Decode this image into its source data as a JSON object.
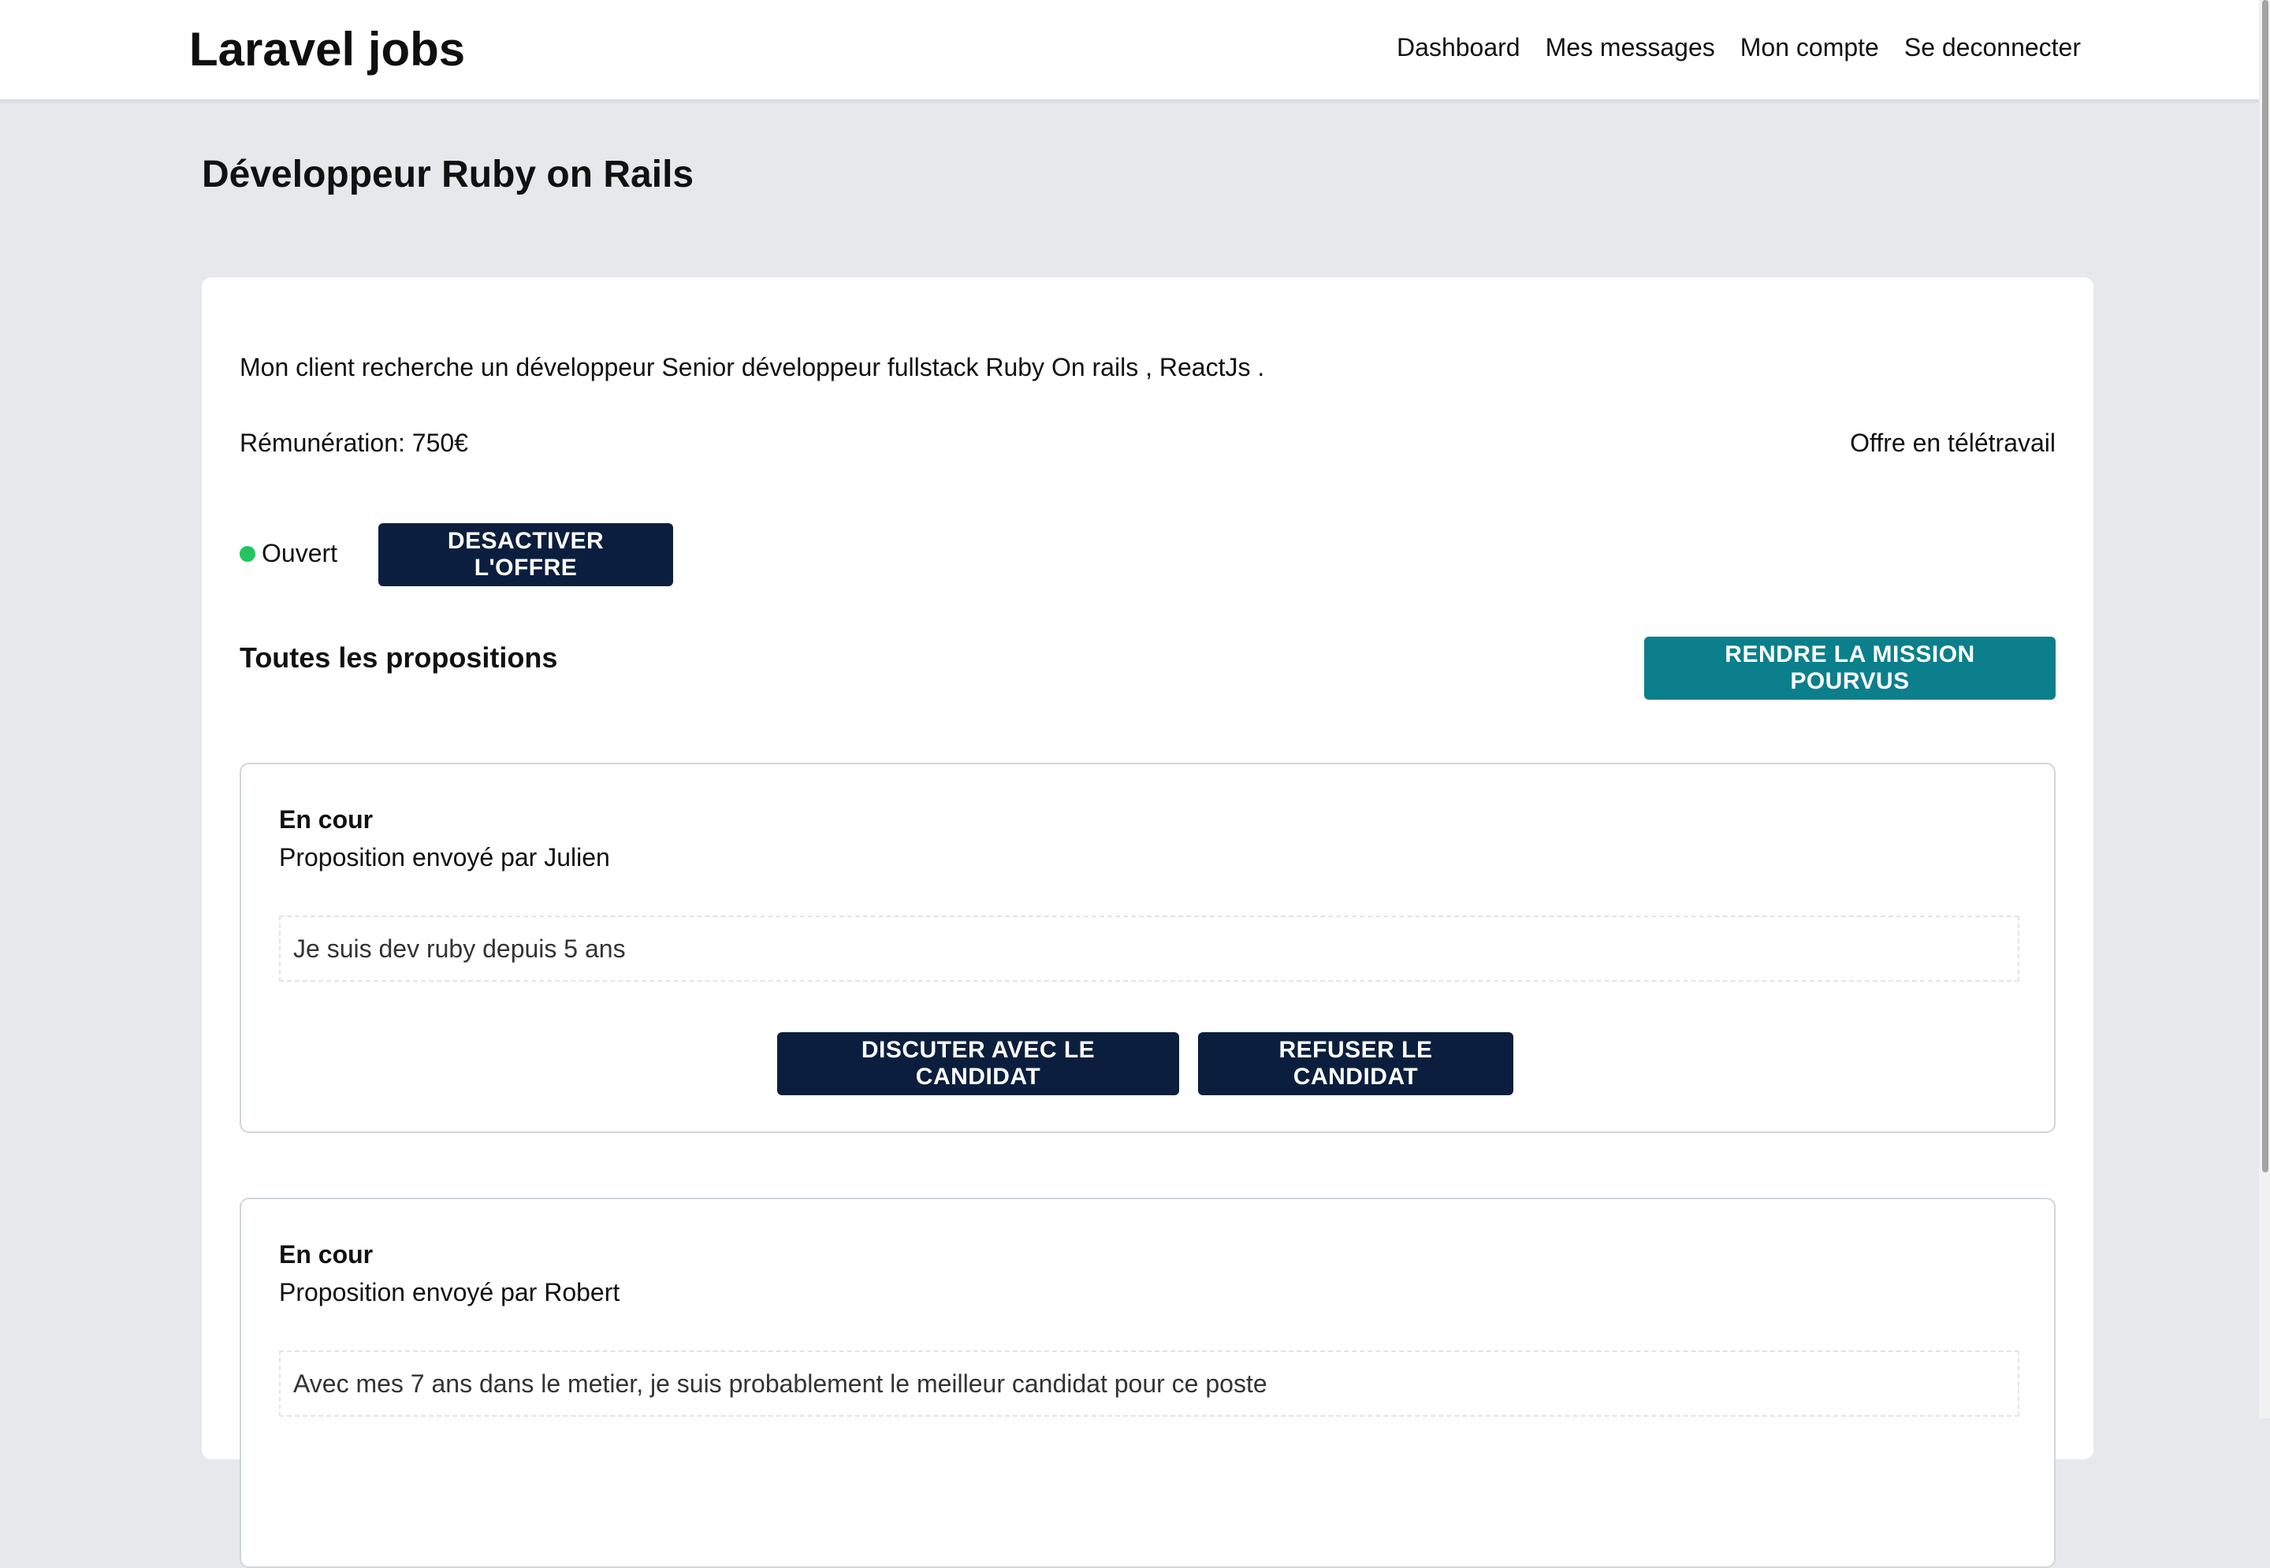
{
  "app": {
    "brand": "Laravel jobs"
  },
  "nav": {
    "items": [
      {
        "label": "Dashboard"
      },
      {
        "label": "Mes messages"
      },
      {
        "label": "Mon compte"
      },
      {
        "label": "Se deconnecter"
      }
    ]
  },
  "job": {
    "title": "Développeur Ruby on Rails",
    "description": "Mon client recherche un développeur Senior développeur fullstack Ruby On rails , ReactJs .",
    "remuneration": "Rémunération: 750€",
    "remote": "Offre en télétravail",
    "status": "Ouvert",
    "status_color": "#22c55e",
    "deactivate_label": "DESACTIVER L'OFFRE"
  },
  "proposals_section": {
    "title": "Toutes les propositions",
    "fulfill_label": "RENDRE LA MISSION POURVUS"
  },
  "proposals": [
    {
      "status": "En cour",
      "sender": "Proposition envoyé par Julien",
      "message": "Je suis dev ruby depuis 5 ans",
      "discuss_label": "DISCUTER AVEC LE CANDIDAT",
      "refuse_label": "REFUSER LE CANDIDAT"
    },
    {
      "status": "En cour",
      "sender": "Proposition envoyé par Robert",
      "message": "Avec mes 7 ans dans le metier, je suis probablement le meilleur candidat pour ce poste"
    }
  ],
  "colors": {
    "primary_button": "#0c1e3e",
    "accent_button": "#0b7f8c",
    "background": "#e6e8ec"
  }
}
